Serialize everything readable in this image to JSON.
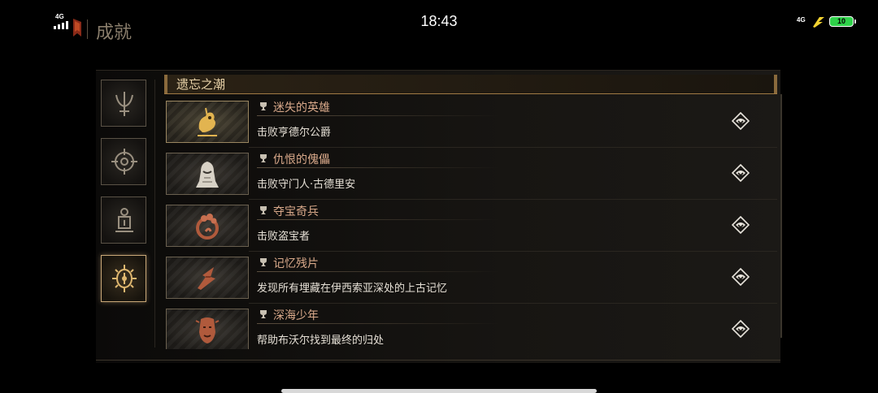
{
  "status_bar": {
    "time": "18:43",
    "network_left": "4G",
    "network_right": "4G",
    "battery": "10",
    "battery_color": "#2fd24a"
  },
  "header": {
    "title": "成就",
    "logo_icon": "game-logo-icon"
  },
  "side_tabs": [
    {
      "icon": "trident-sword-icon",
      "active": false
    },
    {
      "icon": "compass-sigil-icon",
      "active": false
    },
    {
      "icon": "shrine-icon",
      "active": false
    },
    {
      "icon": "eye-sun-icon",
      "active": true
    }
  ],
  "category": {
    "title": "遗忘之潮"
  },
  "achievements": [
    {
      "name": "迷失的英雄",
      "desc": "击败亨德尔公爵",
      "icon": "golden-beast-icon",
      "unlocked": true
    },
    {
      "name": "仇恨的傀儡",
      "desc": "击败守门人·古德里安",
      "icon": "hooded-figure-icon",
      "unlocked": false
    },
    {
      "name": "夺宝奇兵",
      "desc": "击败盗宝者",
      "icon": "snake-flower-icon",
      "unlocked": false
    },
    {
      "name": "记忆残片",
      "desc": "发现所有埋藏在伊西索亚深处的上古记忆",
      "icon": "shard-icon",
      "unlocked": false
    },
    {
      "name": "深海少年",
      "desc": "帮助布沃尔找到最终的归处",
      "icon": "mask-face-icon",
      "unlocked": false
    }
  ],
  "colors": {
    "accent_gold": "#c9a878",
    "achievement_name": "#d9a98a"
  }
}
